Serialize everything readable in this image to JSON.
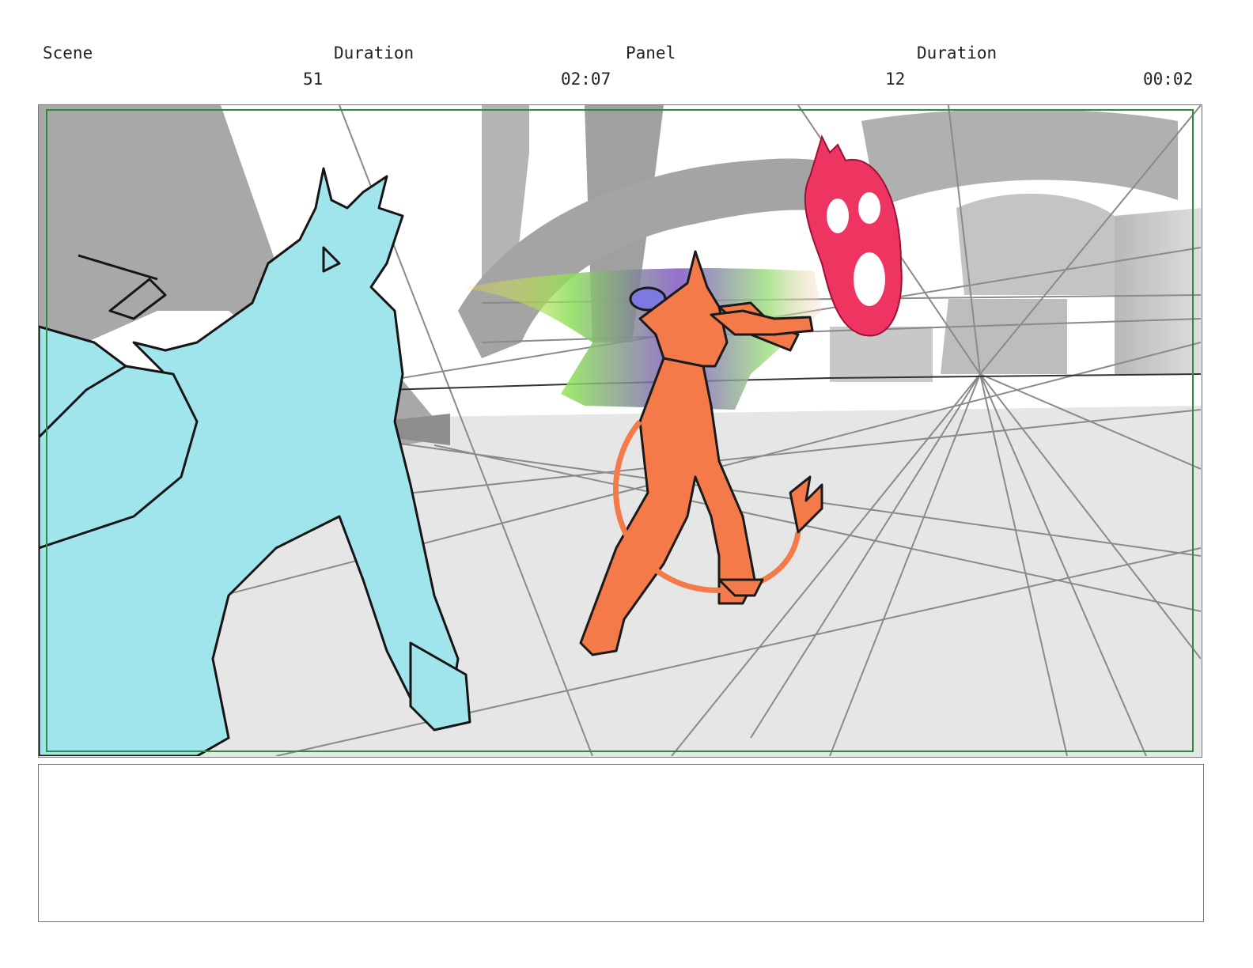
{
  "header": {
    "scene_label": "Scene",
    "scene_value": "51",
    "scene_duration_label": "Duration",
    "scene_duration_value": "02:07",
    "panel_label": "Panel",
    "panel_value": "12",
    "panel_duration_label": "Duration",
    "panel_duration_value": "00:02"
  },
  "colors": {
    "safe_frame": "#2e8b3e",
    "left_character": "#a0e4ec",
    "center_character": "#f47a4a",
    "flying_mask": "#ee3561"
  },
  "notes": {
    "text": ""
  }
}
